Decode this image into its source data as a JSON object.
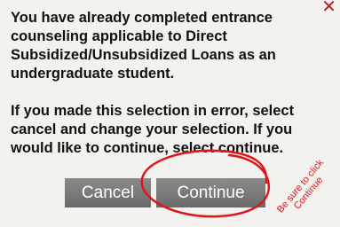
{
  "dialog": {
    "close_icon": "close-icon",
    "message": "You have already completed entrance\ncounseling applicable to Direct\nSubsidized/Unsubsidized Loans as an\nundergraduate student.\n\nIf you made this selection in error, select\ncancel and change your selection. If you\nwould like to continue, select continue.",
    "cancel_label": "Cancel",
    "continue_label": "Continue"
  },
  "annotation": {
    "note_line1": "Be sure to click",
    "note_line2": "Continue",
    "color": "#e0141c"
  }
}
